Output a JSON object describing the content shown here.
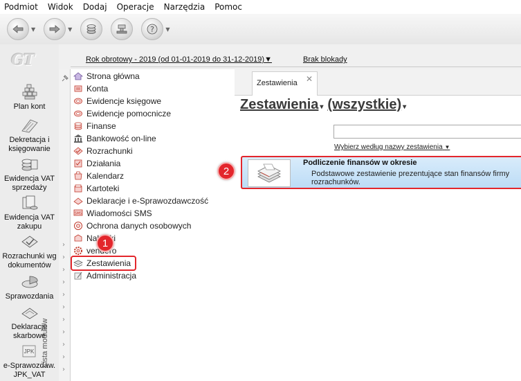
{
  "menu": [
    "Podmiot",
    "Widok",
    "Dodaj",
    "Operacje",
    "Narzędzia",
    "Pomoc"
  ],
  "toolbar": [
    {
      "icon": "back-arrow-icon",
      "has_dropdown": true
    },
    {
      "icon": "forward-arrow-icon",
      "has_dropdown": true
    },
    {
      "icon": "coins-icon",
      "has_dropdown": false
    },
    {
      "icon": "stamp-icon",
      "has_dropdown": false
    },
    {
      "icon": "help-icon",
      "has_dropdown": true
    }
  ],
  "logo_text": "GT",
  "left_rail": [
    {
      "label": "Plan kont",
      "icon": "chart-of-accounts-icon"
    },
    {
      "label": "Dekretacja i księgowanie",
      "icon": "posting-icon"
    },
    {
      "label": "Ewidencja VAT sprzedaży",
      "icon": "vat-sales-icon"
    },
    {
      "label": "Ewidencja VAT zakupu",
      "icon": "vat-purchase-icon"
    },
    {
      "label": "Rozrachunki wg dokumentów",
      "icon": "settlements-icon"
    },
    {
      "label": "Sprawozdania",
      "icon": "reports-icon"
    },
    {
      "label": "Deklaracje skarbowe",
      "icon": "tax-declarations-icon"
    },
    {
      "label": "e-Sprawozdaw. JPK_VAT",
      "icon": "jpk-icon",
      "icon_text": "JPK"
    }
  ],
  "module_strip_label": "Lista modułów",
  "modules": [
    {
      "label": "Strona główna",
      "icon": "home-icon",
      "color": "#8b6bb5"
    },
    {
      "label": "Konta",
      "icon": "accounts-icon",
      "color": "#c0392b"
    },
    {
      "label": "Ewidencje księgowe",
      "icon": "ledger-icon",
      "color": "#c0392b"
    },
    {
      "label": "Ewidencje pomocnicze",
      "icon": "aux-ledger-icon",
      "color": "#c0392b"
    },
    {
      "label": "Finanse",
      "icon": "finance-icon",
      "color": "#c0392b"
    },
    {
      "label": "Bankowość on-line",
      "icon": "bank-icon",
      "color": "#555555"
    },
    {
      "label": "Rozrachunki",
      "icon": "settlements-icon",
      "color": "#c0392b"
    },
    {
      "label": "Działania",
      "icon": "actions-icon",
      "color": "#c0392b"
    },
    {
      "label": "Kalendarz",
      "icon": "calendar-icon",
      "color": "#c0392b"
    },
    {
      "label": "Kartoteki",
      "icon": "files-icon",
      "color": "#c0392b"
    },
    {
      "label": "Deklaracje i e-Sprawozdawczość",
      "icon": "declarations-icon",
      "color": "#c0392b"
    },
    {
      "label": "Wiadomości SMS",
      "icon": "sms-icon",
      "color": "#c0392b"
    },
    {
      "label": "Ochrona danych osobowych",
      "icon": "data-protection-icon",
      "color": "#c0392b"
    },
    {
      "label": "Naklejki",
      "icon": "labels-icon",
      "color": "#c0392b"
    },
    {
      "label": "vendero",
      "icon": "vendero-icon",
      "color": "#c0392b"
    },
    {
      "label": "Zestawienia",
      "icon": "statements-icon",
      "color": "#666666"
    },
    {
      "label": "Administracja",
      "icon": "admin-icon",
      "color": "#777777"
    }
  ],
  "header": {
    "period": "Rok obrotowy - 2019  (od 01-01-2019 do 31-12-2019)",
    "period_caret": "▼",
    "lock": "Brak blokady"
  },
  "tab": {
    "label": "Zestawienia",
    "close": "✕"
  },
  "main": {
    "title": "Zestawienia",
    "filter_value": "(wszystkie)",
    "caret": "▾",
    "search_placeholder": "",
    "search_filter": "Wybierz według nazwy zestawienia"
  },
  "report": {
    "title": "Podliczenie finansów w okresie",
    "description": "Podstawowe zestawienie prezentujące stan finansów firmy rozrachunków."
  },
  "callouts": [
    "1",
    "2"
  ],
  "colors": {
    "highlight": "#e3262c",
    "selection": "#c4e0f8"
  }
}
